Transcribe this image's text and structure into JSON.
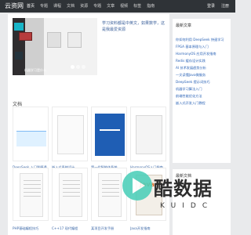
{
  "topbar": {
    "brand": "云资网",
    "nav": [
      "首页",
      "专题",
      "课程",
      "文档",
      "资源",
      "专题",
      "文章",
      "视频",
      "标签",
      "指南"
    ],
    "auth": [
      "登录",
      "注册"
    ]
  },
  "hero": {
    "intro": "学习资料都是中英文，如果数学，这是我最爱资源",
    "caption": "机器学习是什么"
  },
  "section_label": "文档",
  "docs": [
    {
      "label": "DeepSeek 入门到精通"
    },
    {
      "label": "嵌入式系统设计"
    },
    {
      "label": "第一代智能体系统"
    },
    {
      "label": "HarmonyOS入门指南"
    }
  ],
  "docs2": [
    {
      "label": "PHP基础编程技巧"
    },
    {
      "label": "C++17 现代编程"
    },
    {
      "label": "某项目开发手册"
    },
    {
      "label": "Java开发指南"
    }
  ],
  "sidebar": {
    "box1_title": "最新文章",
    "links": [
      "你如何利用 DeepSeek 快速学习",
      "FPGA 基本原理与入门",
      "HarmonyOS 应用开发指南",
      "Redis 缓存设计实践",
      "AI 技术发展趋势分析",
      "一文读懂Java微服务",
      "DeepSeek 提示词技巧",
      "机器学习算法入门",
      "前端性能优化方法",
      "嵌入式开发入门教程"
    ],
    "box2_title": "最新文档"
  },
  "watermark": {
    "title": "酷数据",
    "sub": "KUIDC"
  }
}
